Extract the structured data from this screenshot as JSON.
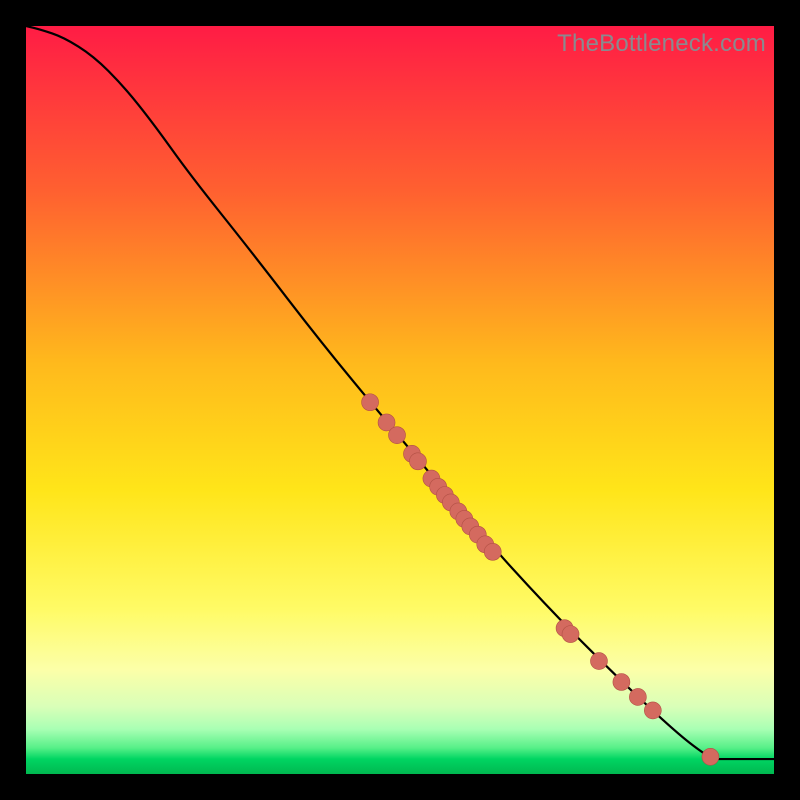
{
  "watermark": "TheBottleneck.com",
  "colors": {
    "curve": "#000000",
    "dot_fill": "#d46a5f",
    "dot_stroke": "#b25045"
  },
  "chart_data": {
    "type": "line",
    "title": "",
    "xlabel": "",
    "ylabel": "",
    "xlim": [
      0,
      1
    ],
    "ylim": [
      0,
      1
    ],
    "curve": [
      {
        "x": 0.0,
        "y": 1.0
      },
      {
        "x": 0.02,
        "y": 0.995
      },
      {
        "x": 0.05,
        "y": 0.985
      },
      {
        "x": 0.09,
        "y": 0.96
      },
      {
        "x": 0.13,
        "y": 0.92
      },
      {
        "x": 0.17,
        "y": 0.87
      },
      {
        "x": 0.22,
        "y": 0.8
      },
      {
        "x": 0.3,
        "y": 0.7
      },
      {
        "x": 0.4,
        "y": 0.57
      },
      {
        "x": 0.5,
        "y": 0.45
      },
      {
        "x": 0.6,
        "y": 0.33
      },
      {
        "x": 0.7,
        "y": 0.22
      },
      {
        "x": 0.8,
        "y": 0.12
      },
      {
        "x": 0.87,
        "y": 0.055
      },
      {
        "x": 0.905,
        "y": 0.028
      },
      {
        "x": 0.92,
        "y": 0.02
      },
      {
        "x": 0.93,
        "y": 0.02
      },
      {
        "x": 1.0,
        "y": 0.02
      }
    ],
    "points": [
      {
        "x": 0.46,
        "y": 0.497
      },
      {
        "x": 0.482,
        "y": 0.47
      },
      {
        "x": 0.496,
        "y": 0.453
      },
      {
        "x": 0.516,
        "y": 0.428
      },
      {
        "x": 0.524,
        "y": 0.418
      },
      {
        "x": 0.542,
        "y": 0.395
      },
      {
        "x": 0.551,
        "y": 0.384
      },
      {
        "x": 0.56,
        "y": 0.373
      },
      {
        "x": 0.568,
        "y": 0.363
      },
      {
        "x": 0.578,
        "y": 0.351
      },
      {
        "x": 0.586,
        "y": 0.341
      },
      {
        "x": 0.594,
        "y": 0.331
      },
      {
        "x": 0.604,
        "y": 0.32
      },
      {
        "x": 0.614,
        "y": 0.307
      },
      {
        "x": 0.624,
        "y": 0.297
      },
      {
        "x": 0.72,
        "y": 0.195
      },
      {
        "x": 0.728,
        "y": 0.187
      },
      {
        "x": 0.766,
        "y": 0.151
      },
      {
        "x": 0.796,
        "y": 0.123
      },
      {
        "x": 0.818,
        "y": 0.103
      },
      {
        "x": 0.838,
        "y": 0.085
      },
      {
        "x": 0.915,
        "y": 0.023
      }
    ],
    "point_radius": 8.5
  }
}
